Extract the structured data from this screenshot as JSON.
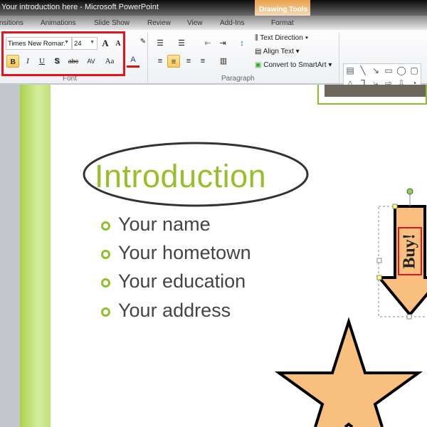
{
  "window": {
    "title": "Your introduction here - Microsoft PowerPoint",
    "context_tab": "Drawing Tools"
  },
  "tabs": [
    "nsitions",
    "Animations",
    "Slide Show",
    "Review",
    "View",
    "Add-Ins",
    "Format"
  ],
  "font_group": {
    "font_name": "Times New Roman",
    "font_size": "24",
    "label": "Font",
    "bold": "B",
    "italic": "I",
    "underline": "U",
    "shadow": "S",
    "strike": "abc",
    "spacing": "AV",
    "case": "Aa",
    "grow": "A",
    "shrink": "A",
    "color": "A"
  },
  "paragraph_group": {
    "label": "Paragraph",
    "text_direction": "Text Direction",
    "align_text": "Align Text",
    "convert": "Convert to SmartArt"
  },
  "shapes": [
    "▤",
    "╲",
    "↘",
    "▭",
    "◯",
    "▢",
    "△",
    "ᒣ",
    "⤷",
    "⇨",
    "⇩",
    "◔",
    "∿",
    "◠",
    "∧",
    "{",
    "}",
    "☆"
  ],
  "slide": {
    "title": "Introduction",
    "bullets": [
      "Your name",
      "Your hometown",
      "Your education",
      "Your address"
    ],
    "arrow_text": "Buy!"
  },
  "colors": {
    "accent": "#97bf29",
    "shape_fill": "#f9bf7f",
    "highlight": "#e3141b"
  }
}
